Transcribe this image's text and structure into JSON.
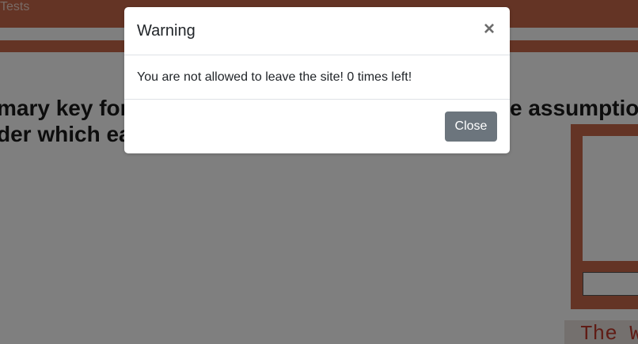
{
  "navbar": {
    "link_label": "Tests"
  },
  "question": {
    "line1_left": "mary key for e",
    "line1_right": "e assumption",
    "line2": "der which eac"
  },
  "side_banner": {
    "text": "The W"
  },
  "modal": {
    "title": "Warning",
    "close_icon_glyph": "×",
    "message": "You are not allowed to leave the site! 0 times left!",
    "close_button_label": "Close"
  },
  "colors": {
    "brand": "#c8694a",
    "close_button": "#6c757d"
  }
}
